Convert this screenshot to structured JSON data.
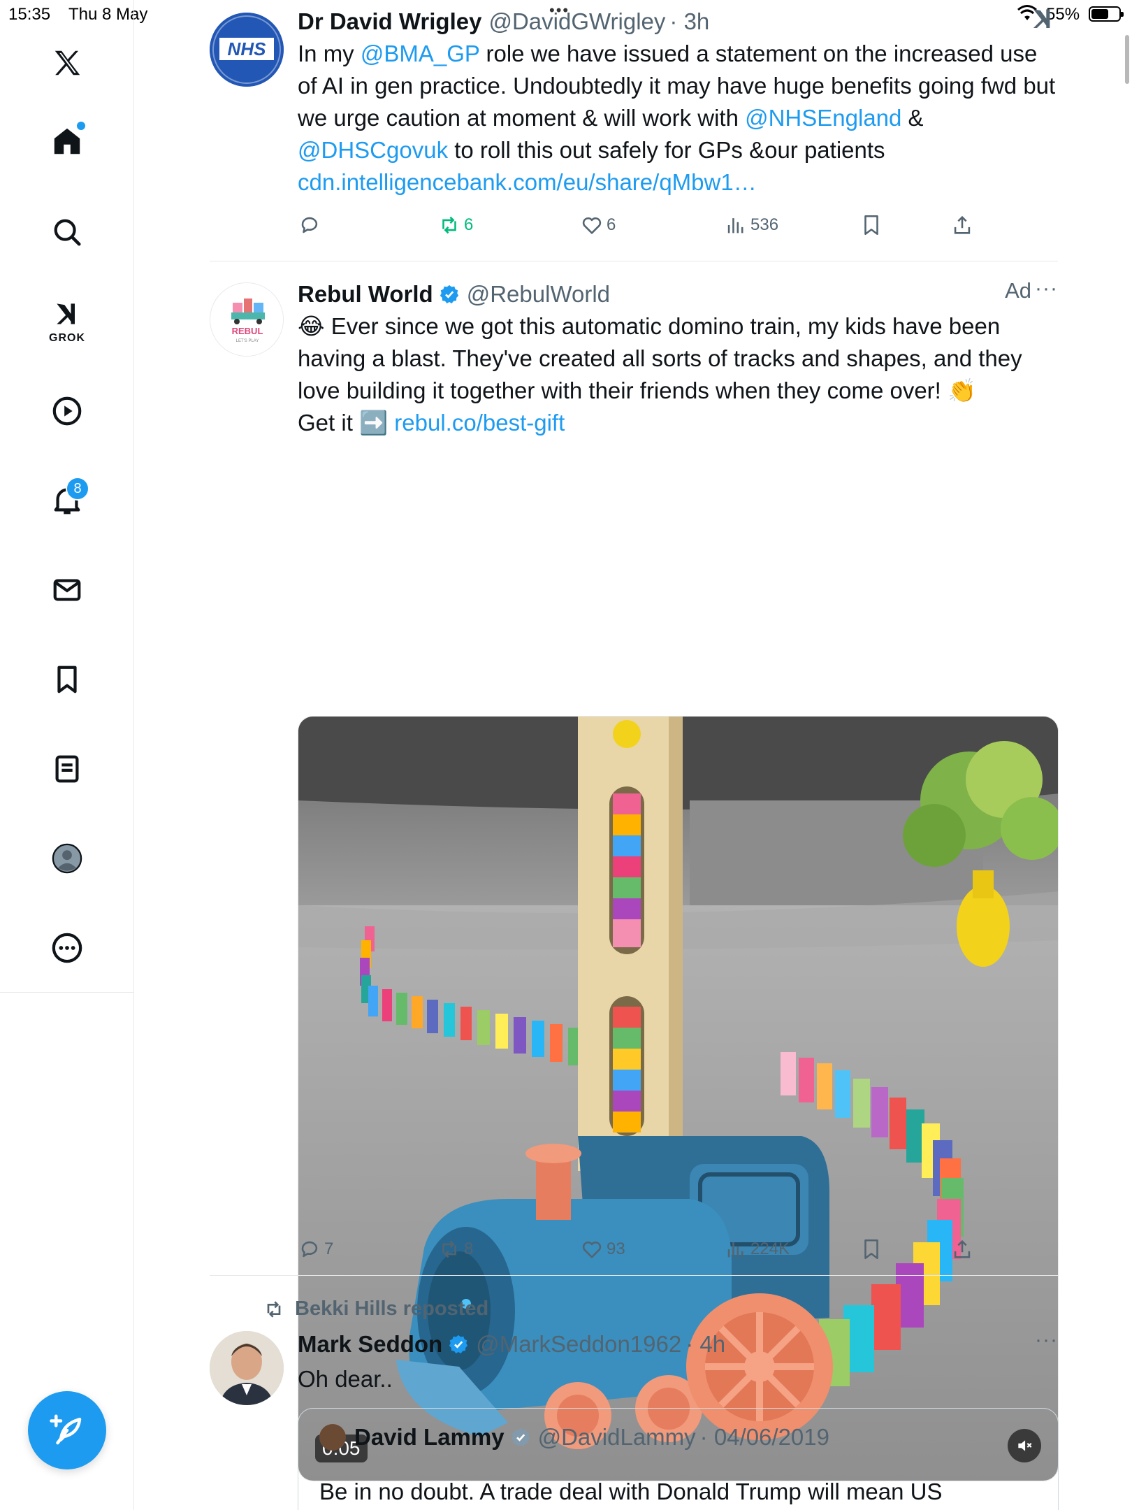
{
  "status_bar": {
    "time": "15:35",
    "date": "Thu 8 May",
    "battery": "55%"
  },
  "sidebar": {
    "grok_label": "GROK",
    "notification_count": "8"
  },
  "tweets": [
    {
      "name": "Dr David Wrigley",
      "handle": "@DavidGWrigley",
      "time": "· 3h",
      "avatar_text": "NHS",
      "text_parts": {
        "t1": "In my ",
        "m1": "@BMA_GP",
        "t2": " role we have issued a statement on the increased use of AI in gen practice. Undoubtedly it may have huge benefits going fwd but we urge caution at moment & will work with ",
        "m2": "@NHSEngland",
        "t3": " & ",
        "m3": "@DHSCgovuk",
        "t4": " to roll this out safely for GPs &our patients ",
        "link": "cdn.intelligencebank.com/eu/share/qMbw1…"
      },
      "stats": {
        "replies": "",
        "reposts": "6",
        "likes": "6",
        "views": "536"
      }
    },
    {
      "name": "Rebul World",
      "handle": "@RebulWorld",
      "ad_label": "Ad",
      "avatar_text": "REBUL",
      "avatar_tagline": "LET'S PLAY",
      "text_parts": {
        "emoji1": "😂",
        "t1": " Ever since we got this automatic domino train, my kids have been having a blast. They've created all sorts of tracks and shapes, and they love building it together with their friends when they come over! ",
        "emoji2": "👏",
        "t2": "Get it ",
        "emoji3": "➡️",
        "link": "rebul.co/best-gift"
      },
      "video_duration": "0:05",
      "stats": {
        "replies": "7",
        "reposts": "8",
        "likes": "93",
        "views": "224K"
      }
    },
    {
      "repost_by": "Bekki Hills reposted",
      "name": "Mark Seddon",
      "handle": "@MarkSeddon1962",
      "time": "· 4h",
      "text": "Oh dear..",
      "quote": {
        "name": "David Lammy",
        "handle": "@DavidLammy",
        "time": "· 04/06/2019",
        "text": "Be in no doubt. A trade deal with Donald Trump will mean US"
      }
    }
  ],
  "colors": {
    "accent": "#1d9bf0",
    "secondary_text": "#536471",
    "repost_green": "#00ba7c"
  }
}
